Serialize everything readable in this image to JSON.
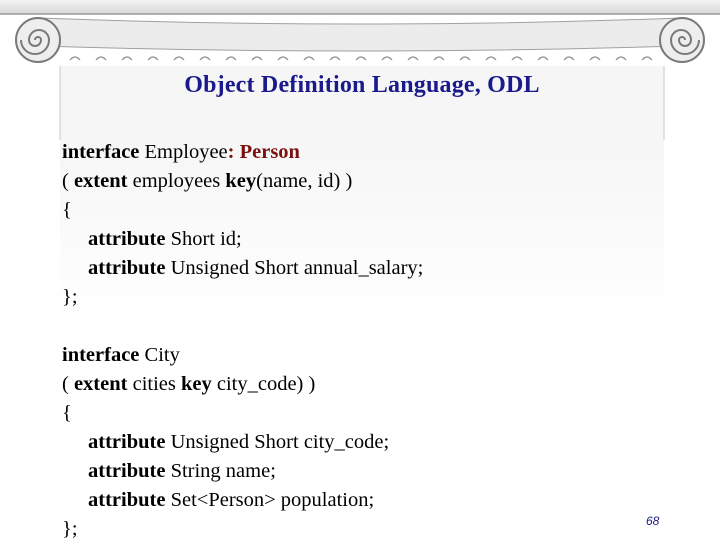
{
  "title": "Object Definition Language, ODL",
  "code": {
    "l1": {
      "kw1": "interface",
      "t1": " Employee",
      "t2": ": ",
      "sup": "Person"
    },
    "l2": {
      "t1": "( ",
      "kw1": "extent",
      "t2": " employees ",
      "kw2": "key",
      "t3": "(name, id) )"
    },
    "l3": "{",
    "l4": {
      "kw": "attribute",
      "t": " Short id;"
    },
    "l5": {
      "kw": "attribute",
      "t": " Unsigned Short annual_salary;"
    },
    "l6": "};",
    "l8": {
      "kw": "interface",
      "t": " City"
    },
    "l9": {
      "t1": "( ",
      "kw1": "extent",
      "t2": " cities ",
      "kw2": "key",
      "t3": " city_code) )"
    },
    "l10": "{",
    "l11": {
      "kw": "attribute",
      "t": " Unsigned Short city_code;"
    },
    "l12": {
      "kw": "attribute",
      "t": " String name;"
    },
    "l13": {
      "kw": "attribute",
      "t": " Set<Person> population;"
    },
    "l14": "};"
  },
  "page_number": "68",
  "colors": {
    "title": "#1a1a8c",
    "supertype": "#7a1010",
    "column": "#e9e9e9"
  }
}
